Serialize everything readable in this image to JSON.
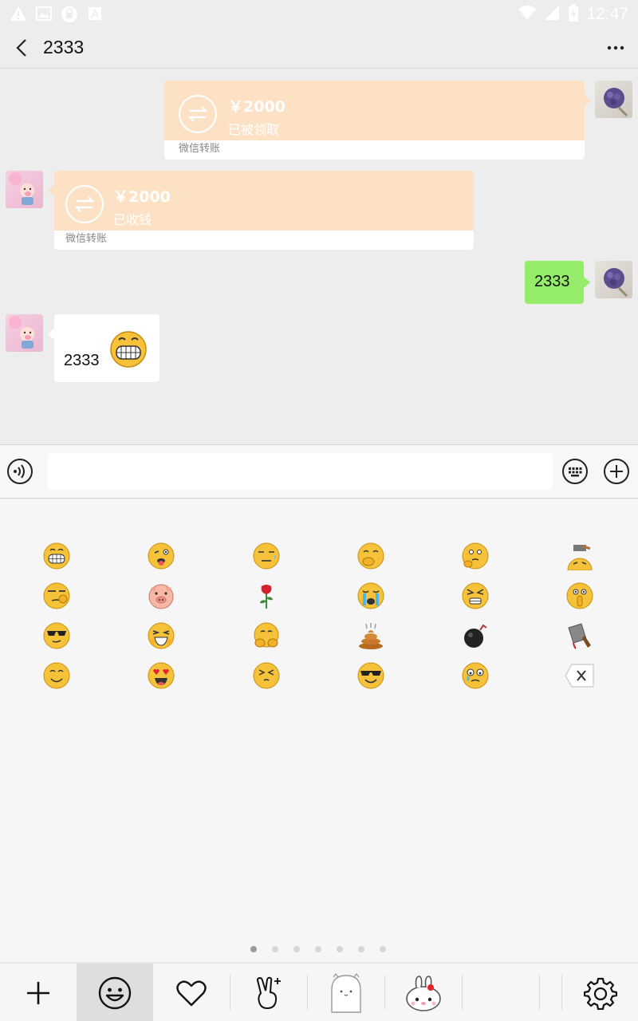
{
  "status_bar": {
    "time": "12:47",
    "left_icons": [
      "warning-icon",
      "image-icon",
      "lock-icon",
      "text-a-icon"
    ],
    "right_icons": [
      "wifi-icon",
      "cellular-icon",
      "battery-icon"
    ]
  },
  "header": {
    "title": "2333",
    "back_icon": "chevron-left-icon",
    "more_icon": "more-icon"
  },
  "messages": [
    {
      "side": "self",
      "type": "transfer",
      "amount": "￥2000",
      "status": "已被领取",
      "footer": "微信转账"
    },
    {
      "side": "other",
      "type": "transfer",
      "amount": "￥2000",
      "status": "已收钱",
      "footer": "微信转账"
    },
    {
      "side": "self",
      "type": "text",
      "text": "2333"
    },
    {
      "side": "other",
      "type": "text",
      "text": "2333",
      "emoji": "grin-emoji"
    }
  ],
  "input_bar": {
    "voice_icon": "voice-icon",
    "value": "",
    "keyboard_icon": "keyboard-icon",
    "plus_icon": "plus-circle-icon"
  },
  "emoji_panel": {
    "emojis": [
      "grin",
      "tongue",
      "awkward",
      "cover-mouth",
      "thinking",
      "hammer-head",
      "salute",
      "pig",
      "rose",
      "crying",
      "grimace",
      "hush",
      "cool-shades",
      "laugh",
      "shy-hands",
      "poop",
      "bomb",
      "cleaver",
      "smile",
      "heart-eyes",
      "squint",
      "sunglasses-smile",
      "teary",
      "delete"
    ],
    "page_count": 7,
    "active_page": 1
  },
  "bottom_tabs": [
    {
      "icon": "add-icon"
    },
    {
      "icon": "smiley-icon",
      "selected": true
    },
    {
      "icon": "heart-icon"
    },
    {
      "icon": "victory-hand-icon"
    },
    {
      "icon": "sticker-ghost-icon"
    },
    {
      "icon": "sticker-bunny-icon"
    },
    {
      "icon": "empty-slot"
    },
    {
      "icon": "settings-gear-icon"
    }
  ],
  "colors": {
    "chat_bg": "#ededed",
    "transfer_bg": "#fde1c4",
    "self_bubble": "#95ec69",
    "other_bubble": "#ffffff",
    "panel_bg": "#f6f6f6",
    "emoji_yellow": "#f6c23a",
    "dot_active": "#9a9a9a",
    "dot_inactive": "#d6d6d6"
  }
}
